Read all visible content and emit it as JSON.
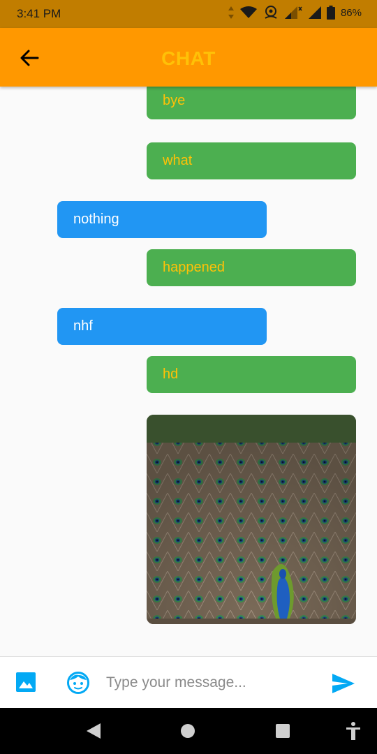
{
  "status_bar": {
    "time": "3:41 PM",
    "battery": "86%"
  },
  "app_bar": {
    "title": "CHAT",
    "back_icon": "arrow-back-icon"
  },
  "messages": [
    {
      "sender": "me",
      "text": "bye"
    },
    {
      "sender": "me",
      "text": "what"
    },
    {
      "sender": "them",
      "text": "nothing"
    },
    {
      "sender": "me",
      "text": "happened"
    },
    {
      "sender": "them",
      "text": "nhf"
    },
    {
      "sender": "me",
      "text": "hd"
    },
    {
      "sender": "me",
      "type": "image",
      "image": "peacock-photo"
    }
  ],
  "composer": {
    "placeholder": "Type your message...",
    "value": "",
    "image_icon": "image-icon",
    "emoji_icon": "face-icon",
    "send_icon": "send-icon"
  },
  "colors": {
    "status_bar": "#c17d00",
    "app_bar": "#ff9800",
    "title": "#ffc107",
    "my_bubble": "#4caf50",
    "my_text": "#ffc107",
    "their_bubble": "#2196f3",
    "their_text": "#ffffff",
    "accent": "#03a9f4"
  }
}
